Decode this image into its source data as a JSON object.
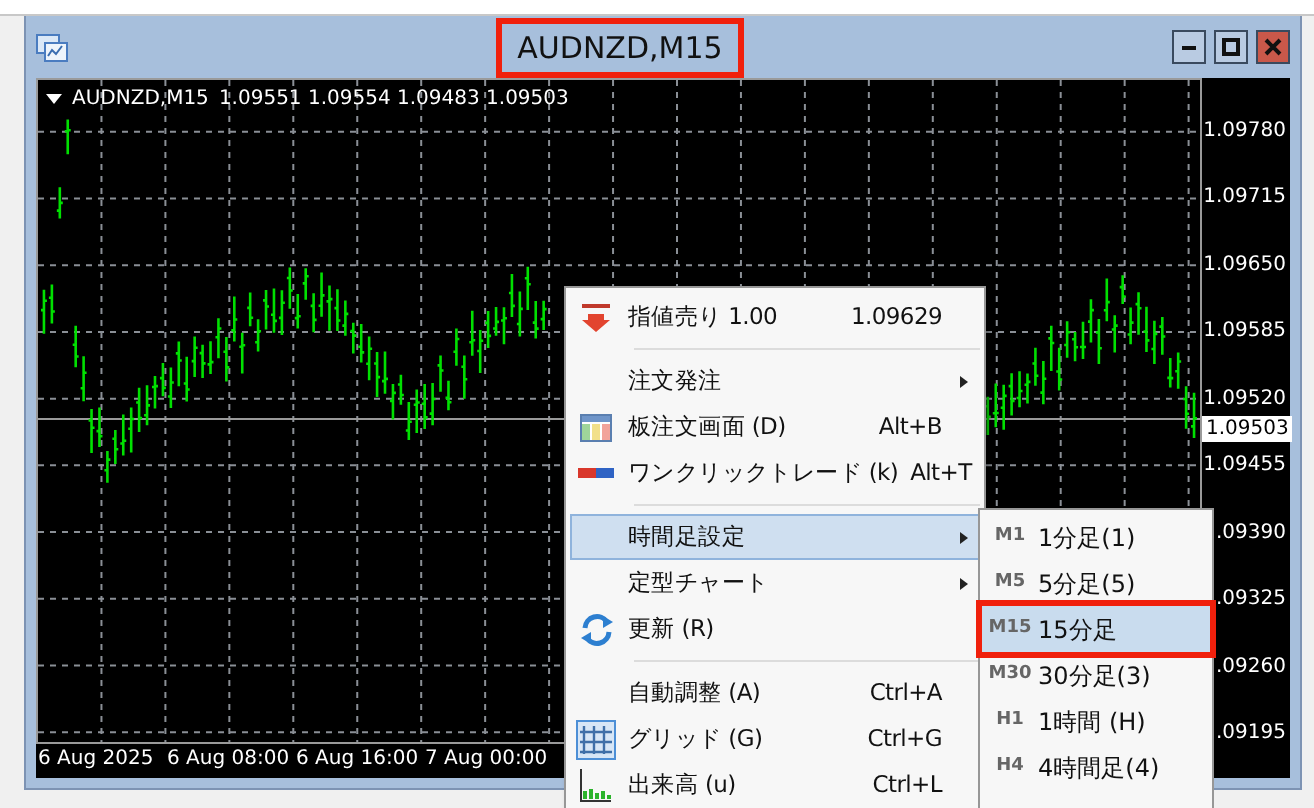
{
  "window": {
    "title": "AUDNZD,M15",
    "title_highlighted": true
  },
  "chart": {
    "legend": {
      "symbol": "AUDNZD,M15",
      "values": [
        "1.09551",
        "1.09554",
        "1.09483",
        "1.09503"
      ]
    },
    "price_axis": [
      "1.09780",
      "1.09715",
      "1.09650",
      "1.09585",
      "1.09520",
      "1.09455",
      ".09390",
      ".09325",
      ".09260",
      ".09195"
    ],
    "current_price": "1.09503",
    "time_axis": [
      "6 Aug 2025",
      "6 Aug 08:00",
      "6 Aug 16:00",
      "7 Aug 00:00"
    ]
  },
  "context_menu": {
    "items": [
      {
        "kind": "item",
        "label": "指値売り 1.00",
        "shortcut": "1.09629",
        "submenu": false,
        "selected": false,
        "checked": false
      },
      {
        "kind": "separator"
      },
      {
        "kind": "item",
        "label": "注文発注",
        "submenu": true,
        "selected": false,
        "checked": false
      },
      {
        "kind": "item",
        "label": "板注文画面 (D)",
        "shortcut": "Alt+B",
        "submenu": false,
        "selected": false,
        "checked": false
      },
      {
        "kind": "item",
        "label": "ワンクリックトレード (k)",
        "shortcut": "Alt+T",
        "submenu": false,
        "selected": false,
        "checked": false
      },
      {
        "kind": "separator"
      },
      {
        "kind": "item",
        "label": "時間足設定",
        "submenu": true,
        "selected": true,
        "checked": false
      },
      {
        "kind": "item",
        "label": "定型チャート",
        "submenu": true,
        "selected": false,
        "checked": false
      },
      {
        "kind": "item",
        "label": "更新 (R)",
        "submenu": false,
        "selected": false,
        "checked": false
      },
      {
        "kind": "separator"
      },
      {
        "kind": "item",
        "label": "自動調整 (A)",
        "shortcut": "Ctrl+A",
        "submenu": false,
        "selected": false,
        "checked": false
      },
      {
        "kind": "item",
        "label": "グリッド (G)",
        "shortcut": "Ctrl+G",
        "submenu": false,
        "selected": false,
        "checked": true
      },
      {
        "kind": "item",
        "label": "出来高 (u)",
        "shortcut": "Ctrl+L",
        "submenu": false,
        "selected": false,
        "checked": false
      }
    ]
  },
  "timeframe_submenu": {
    "items": [
      {
        "code": "M1",
        "label": "1分足(1)",
        "selected": false
      },
      {
        "code": "M5",
        "label": "5分足(5)",
        "selected": false
      },
      {
        "code": "M15",
        "label": "15分足",
        "selected": true
      },
      {
        "code": "M30",
        "label": "30分足(3)",
        "selected": false
      },
      {
        "code": "H1",
        "label": "1時間 (H)",
        "selected": false
      },
      {
        "code": "H4",
        "label": "4時間足(4)",
        "selected": false
      }
    ]
  }
}
